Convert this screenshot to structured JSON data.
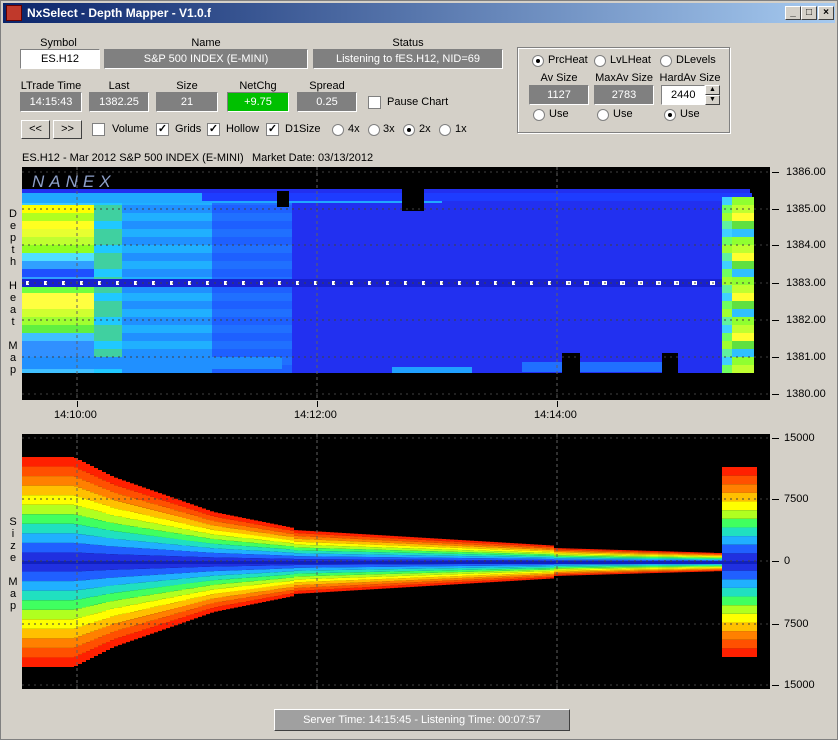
{
  "window": {
    "title": "NxSelect - Depth Mapper - V1.0.f"
  },
  "fields": {
    "symbol": {
      "label": "Symbol",
      "value": "ES.H12"
    },
    "name": {
      "label": "Name",
      "value": "S&P 500 INDEX (E-MINI)"
    },
    "status": {
      "label": "Status",
      "value": "Listening to fES.H12, NID=69"
    },
    "ltrade_time": {
      "label": "LTrade Time",
      "value": "14:15:43"
    },
    "last": {
      "label": "Last",
      "value": "1382.25"
    },
    "size": {
      "label": "Size",
      "value": "21"
    },
    "netchg": {
      "label": "NetChg",
      "value": "+9.75"
    },
    "spread": {
      "label": "Spread",
      "value": "0.25"
    }
  },
  "controls": {
    "pause_chart": "Pause Chart",
    "prev": "<<",
    "next": ">>",
    "volume": "Volume",
    "grids": "Grids",
    "hollow": "Hollow",
    "d1size": "D1Size",
    "zoom_4x": "4x",
    "zoom_3x": "3x",
    "zoom_2x": "2x",
    "zoom_1x": "1x",
    "zoom_selected": "2x"
  },
  "heat_panel": {
    "prcheat": "PrcHeat",
    "lvlheat": "LvLHeat",
    "dlevels": "DLevels",
    "selected": "PrcHeat",
    "av_size": {
      "label": "Av Size",
      "value": "1127"
    },
    "maxav_size": {
      "label": "MaxAv Size",
      "value": "2783"
    },
    "hardav_size": {
      "label": "HardAv Size",
      "value": "2440"
    },
    "use": "Use",
    "use_selected": "HardAv Size"
  },
  "chart_header": {
    "symbol_desc": "ES.H12 - Mar 2012 S&P 500 INDEX (E-MINI)",
    "market_date": "Market Date: 03/13/2012",
    "watermark": "NANEX"
  },
  "depth_map": {
    "side_label": "Depth Heat Map",
    "price_ticks": [
      "1386.00",
      "1385.00",
      "1384.00",
      "1383.00",
      "1382.00",
      "1381.00",
      "1380.00"
    ],
    "time_ticks": [
      "14:10:00",
      "14:12:00",
      "14:14:00"
    ]
  },
  "size_map": {
    "side_label": "Size Map",
    "size_ticks": [
      "15000",
      "7500",
      "0",
      "7500",
      "15000"
    ]
  },
  "statusbar": {
    "text": "Server Time: 14:15:45  -  Listening Time: 00:07:57"
  },
  "colors": {
    "title_start": "#0a246a",
    "title_end": "#a6caf0",
    "netchg_bg": "#00c000",
    "depth_blue": "#2030ff"
  }
}
